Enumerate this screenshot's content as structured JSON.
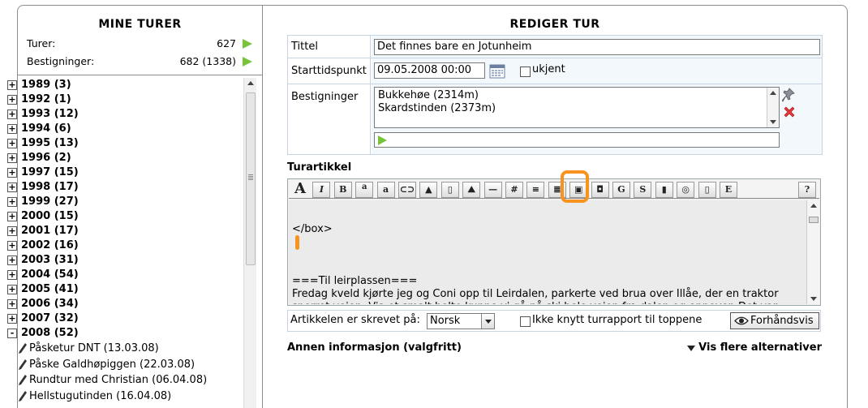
{
  "left": {
    "title": "MINE TURER",
    "stats": [
      {
        "label": "Turer:",
        "value": "627"
      },
      {
        "label": "Bestigninger:",
        "value": "682 (1338)"
      }
    ],
    "years": [
      {
        "label": "1989 (3)",
        "sign": "+"
      },
      {
        "label": "1992 (1)",
        "sign": "+"
      },
      {
        "label": "1993 (12)",
        "sign": "+"
      },
      {
        "label": "1994 (6)",
        "sign": "+"
      },
      {
        "label": "1995 (13)",
        "sign": "+"
      },
      {
        "label": "1996 (2)",
        "sign": "+"
      },
      {
        "label": "1997 (15)",
        "sign": "+"
      },
      {
        "label": "1998 (17)",
        "sign": "+"
      },
      {
        "label": "1999 (27)",
        "sign": "+"
      },
      {
        "label": "2000 (15)",
        "sign": "+"
      },
      {
        "label": "2001 (17)",
        "sign": "+"
      },
      {
        "label": "2002 (16)",
        "sign": "+"
      },
      {
        "label": "2003 (31)",
        "sign": "+"
      },
      {
        "label": "2004 (54)",
        "sign": "+"
      },
      {
        "label": "2005 (41)",
        "sign": "+"
      },
      {
        "label": "2006 (34)",
        "sign": "+"
      },
      {
        "label": "2007 (32)",
        "sign": "+"
      },
      {
        "label": "2008 (52)",
        "sign": "-"
      }
    ],
    "trips": [
      "Påsketur DNT (13.03.08)",
      "Påske Galdhøpiggen (22.03.08)",
      "Rundtur med Christian (06.04.08)",
      "Hellstugutinden (16.04.08)"
    ]
  },
  "right": {
    "title": "REDIGER TUR",
    "labels": {
      "title": "Tittel",
      "start": "Starttidspunkt",
      "climbs": "Bestigninger"
    },
    "title_value": "Det finnes bare en Jotunheim",
    "start_value": "09.05.2008 00:00",
    "unknown_label": "ukjent",
    "climbs": [
      "Bukkehøe (2314m)",
      "Skardstinden (2373m)"
    ],
    "article_label": "Turartikkel",
    "toolbar": [
      "A",
      "I",
      "B",
      "a",
      "a",
      "link",
      "mountain",
      "boot",
      "hiker",
      "hr",
      "table",
      "ul",
      "ol",
      "image",
      "image-text",
      "G",
      "S",
      "book",
      "gallery",
      "page",
      "E",
      "?"
    ],
    "article_lines": [
      "",
      "</box>",
      "",
      "",
      "",
      "===Til leirplassen===",
      "Fredag kveld kjørte jeg og Coni opp til Leirdalen, parkerte ved brua over Illåe, der en traktor",
      "sperret veien. Via et smalt belte kunne vi gå på ski hele veien fra dalen og oppover. Det var"
    ],
    "language_label": "Artikkelen er skrevet på:",
    "language_value": "Norsk",
    "nolink_label": "Ikke knytt turrapport til toppene",
    "preview_label": "Forhåndsvis",
    "other_info": "Annen informasjon (valgfritt)",
    "more_options": "Vis flere alternativer"
  },
  "colors": {
    "accent_green": "#77c43a",
    "highlight_orange": "#f7931e",
    "border": "#8c8c8c"
  }
}
